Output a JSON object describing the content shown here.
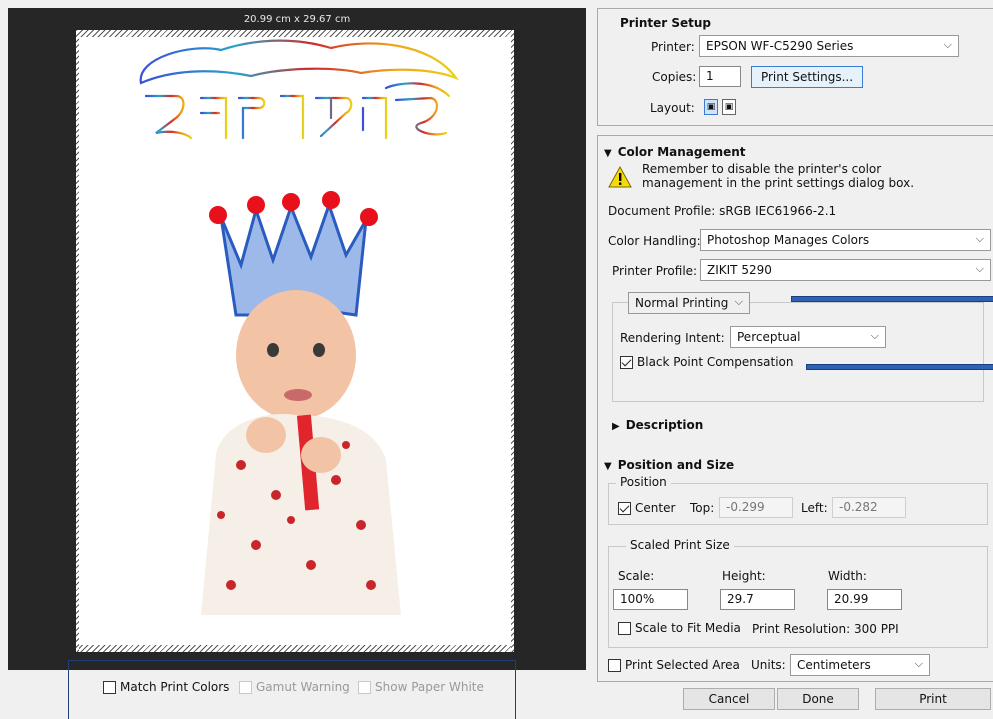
{
  "preview": {
    "dimensions": "20.99 cm x 29.67 cm",
    "logo_text": "זקית דיגיטל",
    "match_print_colors": "Match Print Colors",
    "gamut_warning": "Gamut Warning",
    "show_paper_white": "Show Paper White"
  },
  "printer_setup": {
    "title": "Printer Setup",
    "printer_label": "Printer:",
    "printer_value": "EPSON WF-C5290 Series",
    "copies_label": "Copies:",
    "copies_value": "1",
    "print_settings_button": "Print Settings...",
    "layout_label": "Layout:"
  },
  "color_management": {
    "title": "Color Management",
    "warning_line1": "Remember to disable the printer's color",
    "warning_line2": "management in the print settings dialog box.",
    "document_profile": "Document Profile: sRGB IEC61966-2.1",
    "color_handling_label": "Color Handling:",
    "color_handling_value": "Photoshop Manages Colors",
    "printer_profile_label": "Printer Profile:",
    "printer_profile_value": "ZIKIT 5290",
    "printing_mode": "Normal Printing",
    "rendering_intent_label": "Rendering Intent:",
    "rendering_intent_value": "Perceptual",
    "black_point_compensation": "Black Point Compensation"
  },
  "description": {
    "title": "Description"
  },
  "position_size": {
    "title": "Position and Size",
    "position_legend": "Position",
    "center_label": "Center",
    "top_label": "Top:",
    "top_value": "-0.299",
    "left_label": "Left:",
    "left_value": "-0.282",
    "scaled_legend": "Scaled Print Size",
    "scale_label": "Scale:",
    "height_label": "Height:",
    "width_label": "Width:",
    "scale_value": "100%",
    "height_value": "29.7",
    "width_value": "20.99",
    "scale_to_fit": "Scale to Fit Media",
    "print_resolution": "Print Resolution: 300 PPI",
    "print_selected_area": "Print Selected Area",
    "units_label": "Units:",
    "units_value": "Centimeters"
  },
  "footer": {
    "cancel": "Cancel",
    "done": "Done",
    "print": "Print"
  },
  "colors": {
    "accent": "#2f62b3",
    "preview_bg": "#262626",
    "panel_bg": "#f0f0f0"
  }
}
